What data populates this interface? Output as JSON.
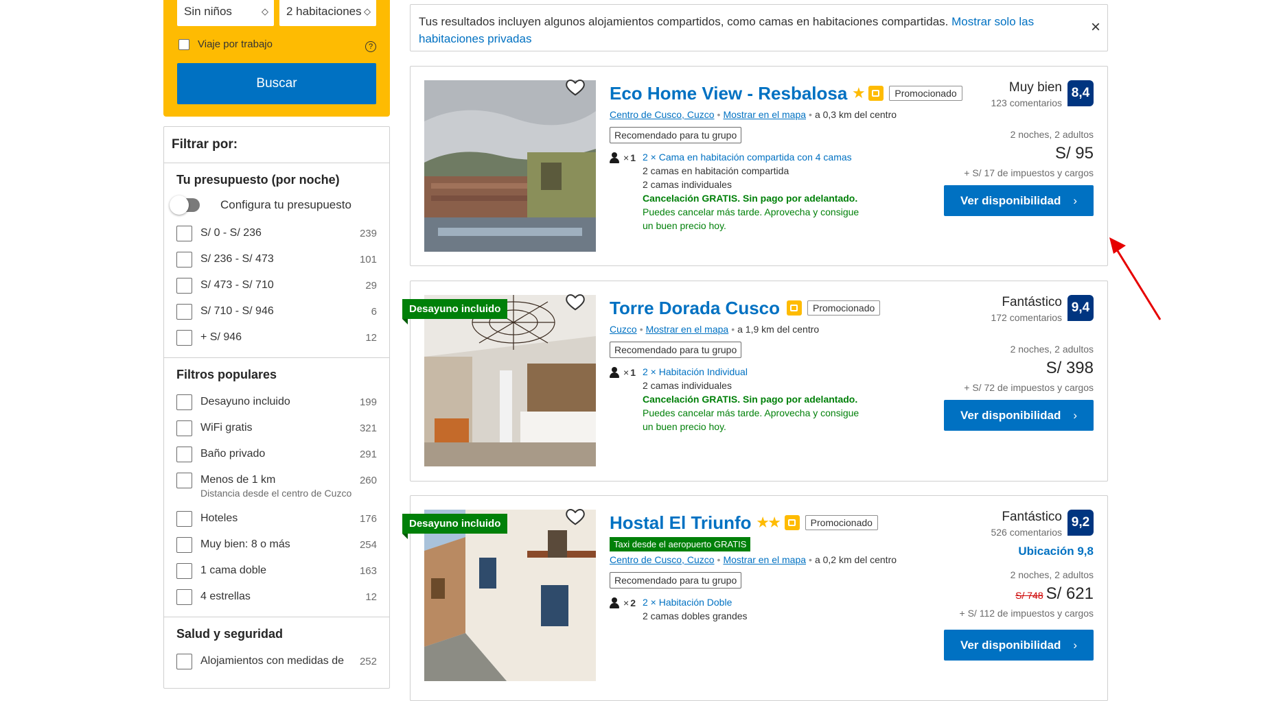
{
  "search": {
    "children_select": "Sin niños",
    "rooms_select": "2 habitaciones",
    "work_trip_label": "Viaje por trabajo",
    "help_glyph": "?",
    "search_button": "Buscar"
  },
  "filters": {
    "title": "Filtrar por:",
    "budget": {
      "title": "Tu presupuesto (por noche)",
      "toggle_label": "Configura tu presupuesto",
      "options": [
        {
          "label": "S/ 0 - S/ 236",
          "count": "239"
        },
        {
          "label": "S/ 236 - S/ 473",
          "count": "101"
        },
        {
          "label": "S/ 473 - S/ 710",
          "count": "29"
        },
        {
          "label": "S/ 710 - S/ 946",
          "count": "6"
        },
        {
          "label": "+ S/ 946",
          "count": "12"
        }
      ]
    },
    "popular": {
      "title": "Filtros populares",
      "options": [
        {
          "label": "Desayuno incluido",
          "count": "199"
        },
        {
          "label": "WiFi gratis",
          "count": "321"
        },
        {
          "label": "Baño privado",
          "count": "291"
        },
        {
          "label": "Menos de 1 km",
          "count": "260",
          "sub": "Distancia desde el centro de Cuzco"
        },
        {
          "label": "Hoteles",
          "count": "176"
        },
        {
          "label": "Muy bien: 8 o más",
          "count": "254"
        },
        {
          "label": "1 cama doble",
          "count": "163"
        },
        {
          "label": "4 estrellas",
          "count": "12"
        }
      ]
    },
    "health": {
      "title": "Salud y seguridad",
      "options": [
        {
          "label": "Alojamientos con medidas de",
          "count": "252"
        }
      ]
    }
  },
  "banner": {
    "text": "Tus resultados incluyen algunos alojamientos compartidos, como camas en habitaciones compartidas.",
    "link": "Mostrar solo las habitaciones privadas",
    "close": "×"
  },
  "hotels": [
    {
      "name": "Eco Home View - Resbalosa",
      "stars": "★",
      "promo": "Promocionado",
      "location_link": "Centro de Cusco, Cuzco",
      "map_link": "Mostrar en el mapa",
      "distance": "a 0,3 km del centro",
      "group": "Recomendado para tu grupo",
      "occupancy": "1",
      "room_type": "2 × Cama en habitación compartida con 4 camas",
      "beds": [
        "2 camas en habitación compartida",
        "2 camas individuales"
      ],
      "cancel": "Cancelación GRATIS. Sin pago por adelantado.",
      "cancel_note": "Puedes cancelar más tarde. Aprovecha y consigue un buen precio hoy.",
      "score_label": "Muy bien",
      "reviews": "123 comentarios",
      "score": "8,4",
      "nights": "2 noches, 2 adultos",
      "price": "S/ 95",
      "taxes": "+ S/ 17 de impuestos y cargos",
      "button": "Ver disponibilidad",
      "photo_colors": {
        "sky": "#c9ccd0",
        "city": "#8a5f4a",
        "terrace": "#6e7a86"
      }
    },
    {
      "name": "Torre Dorada Cusco",
      "ribbon": "Desayuno incluido",
      "promo": "Promocionado",
      "location_link": "Cuzco",
      "map_link": "Mostrar en el mapa",
      "distance": "a 1,9 km del centro",
      "group": "Recomendado para tu grupo",
      "occupancy": "1",
      "room_type": "2 × Habitación Individual",
      "beds": [
        "2 camas individuales"
      ],
      "cancel": "Cancelación GRATIS. Sin pago por adelantado.",
      "cancel_note": "Puedes cancelar más tarde. Aprovecha y consigue un buen precio hoy.",
      "score_label": "Fantástico",
      "reviews": "172 comentarios",
      "score": "9,4",
      "nights": "2 noches, 2 adultos",
      "price": "S/ 398",
      "taxes": "+ S/ 72 de impuestos y cargos",
      "button": "Ver disponibilidad"
    },
    {
      "name": "Hostal El Triunfo",
      "stars": "★★",
      "ribbon": "Desayuno incluido",
      "promo": "Promocionado",
      "taxi": "Taxi desde el aeropuerto GRATIS",
      "location_link": "Centro de Cusco, Cuzco",
      "map_link": "Mostrar en el mapa",
      "distance": "a 0,2 km del centro",
      "group": "Recomendado para tu grupo",
      "occupancy": "2",
      "room_type": "2 × Habitación Doble",
      "beds": [
        "2 camas dobles grandes"
      ],
      "score_label": "Fantástico",
      "reviews": "526 comentarios",
      "score": "9,2",
      "location_score": "Ubicación 9,8",
      "nights": "2 noches, 2 adultos",
      "old_price": "S/ 748",
      "price": "S/ 621",
      "taxes": "+ S/ 112 de impuestos y cargos",
      "button": "Ver disponibilidad"
    }
  ],
  "colors": {
    "brand_blue": "#0071c2",
    "search_yellow": "#febb02",
    "score_navy": "#003580",
    "green": "#008009",
    "arrow_red": "#e60000"
  }
}
